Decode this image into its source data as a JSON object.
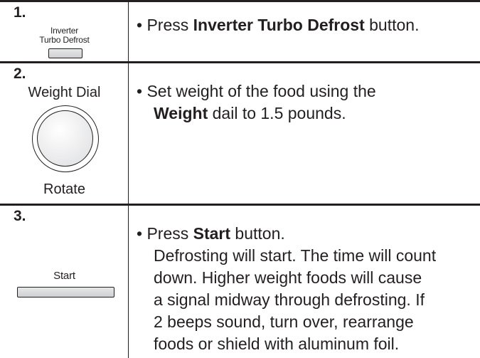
{
  "steps": [
    {
      "number": "1.",
      "control_label_line1": "Inverter",
      "control_label_line2": "Turbo Defrost",
      "instruction_prefix": "• Press ",
      "instruction_bold": "Inverter Turbo Defrost",
      "instruction_suffix": " button."
    },
    {
      "number": "2.",
      "control_label_top": "Weight Dial",
      "control_label_bottom": "Rotate",
      "instruction_line1": "• Set weight of the food using the",
      "instruction_bold": "Weight",
      "instruction_suffix": " dail to 1.5 pounds."
    },
    {
      "number": "3.",
      "control_label": "Start",
      "instruction_prefix": "• Press ",
      "instruction_bold": "Start",
      "instruction_suffix": " button.",
      "instruction_lines": [
        "Defrosting will start. The time will count",
        "down. Higher weight foods will cause",
        "a signal midway through defrosting. If",
        "2 beeps sound, turn over, rearrange",
        "foods or shield with aluminum foil."
      ]
    }
  ]
}
